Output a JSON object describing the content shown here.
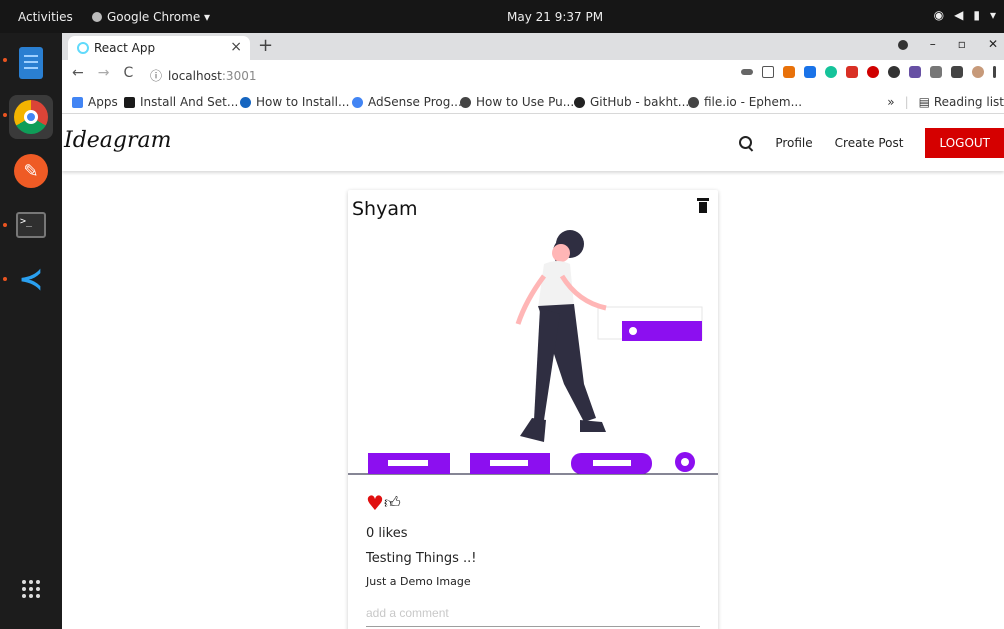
{
  "topbar": {
    "activities": "Activities",
    "app_name": "Google Chrome ▾",
    "clock": "May 21  9:37 PM",
    "tray": [
      "wifi-icon",
      "volume-icon",
      "battery-icon",
      "power-menu-icon"
    ]
  },
  "dock": {
    "apps": [
      "files-icon",
      "chrome-icon",
      "postman-icon",
      "terminal-icon",
      "vscode-icon"
    ],
    "show_apps": "app-grid-icon"
  },
  "browser": {
    "tab_title": "React App",
    "tab_close": "×",
    "new_tab": "+",
    "url_host": "localhost",
    "url_port": ":3001",
    "bookmarks": [
      {
        "label": "Apps",
        "color": "#4285f4"
      },
      {
        "label": "Install And Set...",
        "color": "#1a1a1a"
      },
      {
        "label": "How to Install...",
        "color": "#1565c0"
      },
      {
        "label": "AdSense Prog...",
        "color": "#4285f4"
      },
      {
        "label": "How to Use Pu...",
        "color": "#444444"
      },
      {
        "label": "GitHub - bakht...",
        "color": "#222222"
      },
      {
        "label": "file.io - Ephem...",
        "color": "#444444"
      }
    ],
    "bookmarks_more": "»",
    "reading_list": "Reading list"
  },
  "app": {
    "logo": "Ideagram",
    "nav": {
      "profile": "Profile",
      "create_post": "Create Post",
      "logout": "LOGOUT"
    },
    "colors": {
      "accent": "#d50000",
      "illustration": "#8c0ff0",
      "heart": "#e01010"
    },
    "post": {
      "author": "Shyam",
      "likes": "0 likes",
      "title": "Testing Things ..!",
      "body": "Just a Demo Image",
      "comment_placeholder": "add a comment"
    }
  }
}
